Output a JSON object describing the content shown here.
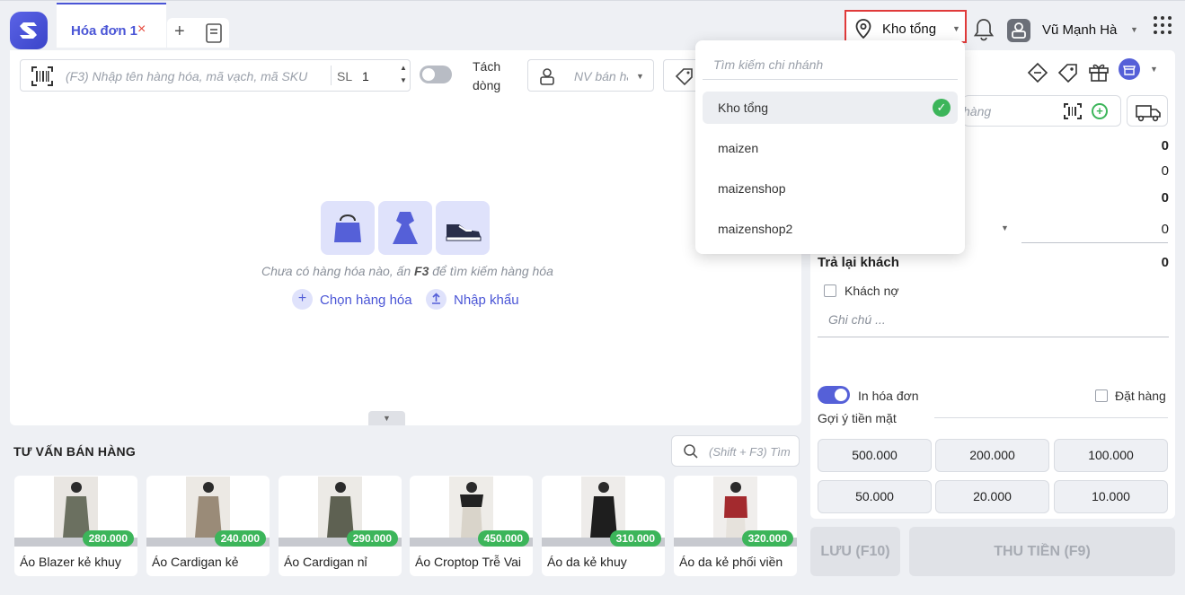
{
  "tabs": [
    {
      "label": "Hóa đơn 1",
      "close": "×"
    }
  ],
  "tab_add": "+",
  "header": {
    "branch": "Kho tổng",
    "user_name": "Vũ Mạnh Hà"
  },
  "toolbar": {
    "search_placeholder": "(F3) Nhập tên hàng hóa, mã vạch, mã SKU",
    "qty_label": "SL",
    "qty_value": "1",
    "split_label": "Tách dòng",
    "seller_placeholder": "NV bán hàng"
  },
  "empty_state": {
    "message_prefix": "Chưa có hàng hóa nào, ấn ",
    "message_key": "F3",
    "message_suffix": " để tìm kiếm hàng hóa",
    "choose_label": "Chọn hàng hóa",
    "import_label": "Nhập khẩu"
  },
  "suggestions": {
    "title": "TƯ VẤN BÁN HÀNG",
    "search_placeholder": "(Shift + F3) Tìm",
    "products": [
      {
        "name": "Áo Blazer kẻ khuy",
        "price": "280.000"
      },
      {
        "name": "Áo Cardigan kẻ",
        "price": "240.000"
      },
      {
        "name": "Áo Cardigan nỉ",
        "price": "290.000"
      },
      {
        "name": "Áo Croptop Trễ Vai",
        "price": "450.000"
      },
      {
        "name": "Áo da kẻ khuy",
        "price": "310.000"
      },
      {
        "name": "Áo da kẻ phối viền",
        "price": "320.000"
      }
    ]
  },
  "checkout": {
    "customer_placeholder": "hàng",
    "values": [
      "0",
      "0",
      "0",
      "0"
    ],
    "return_label": "Trả lại khách",
    "return_value": "0",
    "debt_label": "Khách nợ",
    "note_placeholder": "Ghi chú ...",
    "print_label": "In hóa đơn",
    "order_label": "Đặt hàng",
    "cash_label": "Gợi ý tiền mặt",
    "cash_options": [
      "500.000",
      "200.000",
      "100.000",
      "50.000",
      "20.000",
      "10.000"
    ],
    "save_label": "LƯU (F10)",
    "pay_label": "THU TIỀN (F9)"
  },
  "branch_dropdown": {
    "search_placeholder": "Tìm kiếm chi nhánh",
    "items": [
      "Kho tổng",
      "maizen",
      "maizenshop",
      "maizenshop2"
    ],
    "selected": "Kho tổng"
  },
  "colors": {
    "accent": "#4a55d6",
    "success": "#3cb55a",
    "highlight_border": "#e03a3a"
  }
}
